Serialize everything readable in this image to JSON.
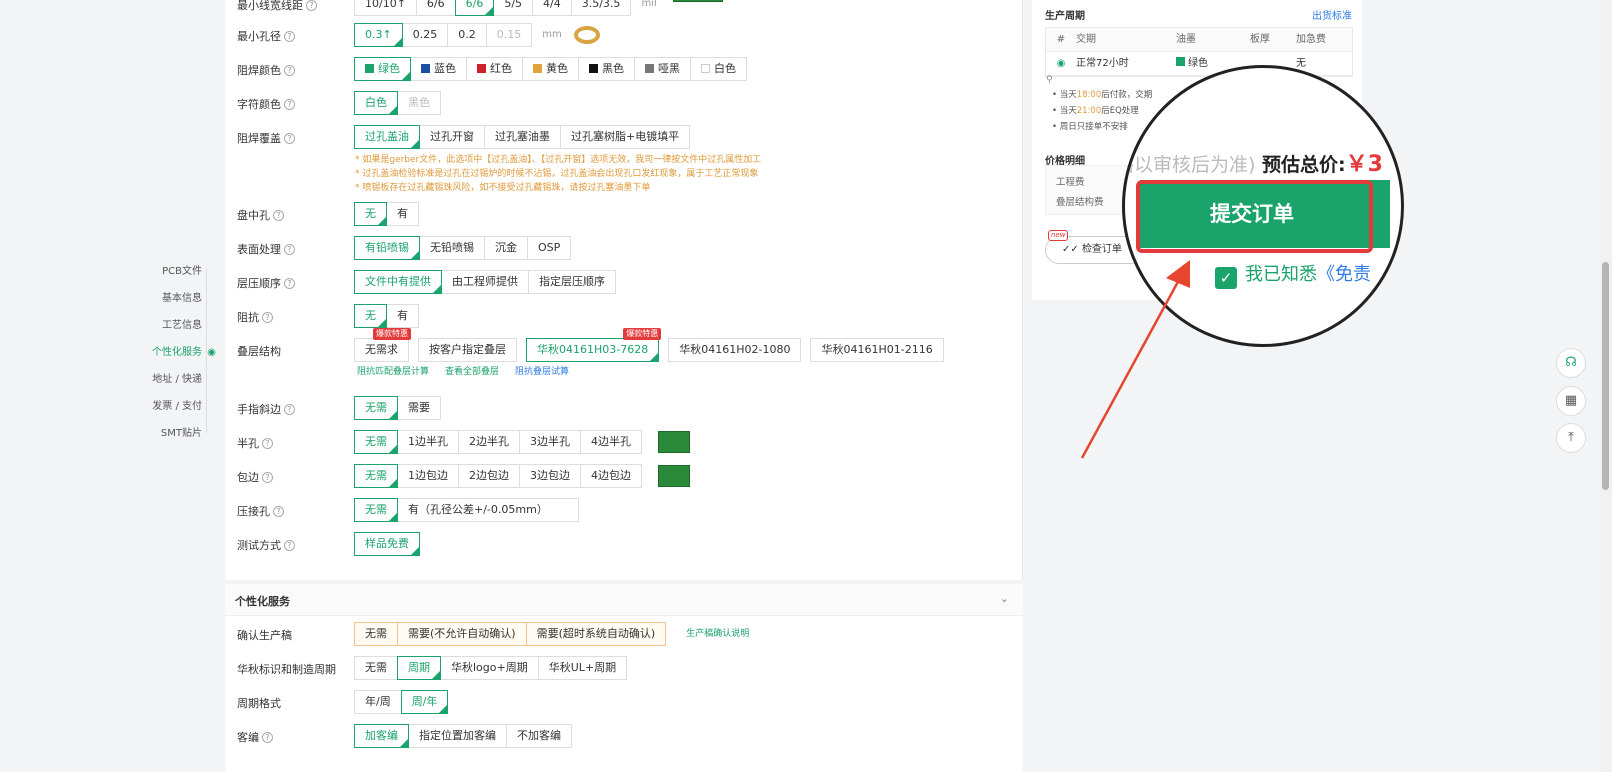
{
  "nav": {
    "items": [
      "PCB文件",
      "基本信息",
      "工艺信息",
      "个性化服务",
      "地址 / 快递",
      "发票 / 支付",
      "SMT贴片"
    ],
    "active_index": 3,
    "pin_icon": "location-pin-icon"
  },
  "spec": {
    "trace": {
      "label": "最小线宽线距",
      "options": [
        "10/10↑",
        "6/6",
        "6/6",
        "5/5",
        "4/4",
        "3.5/3.5"
      ],
      "selected": 2,
      "unit": "mil"
    },
    "hole": {
      "label": "最小孔径",
      "options": [
        "0.3↑",
        "0.25",
        "0.2",
        "0.15"
      ],
      "selected": 0,
      "unit": "mm"
    },
    "mask_color": {
      "label": "阻焊颜色",
      "options": [
        "绿色",
        "蓝色",
        "红色",
        "黄色",
        "黑色",
        "哑黑",
        "白色"
      ],
      "swatches": [
        "#1aa36b",
        "#1c4fa3",
        "#d0202a",
        "#e0a23b",
        "#111111",
        "#777777",
        "#ffffff"
      ],
      "selected": 0
    },
    "silk_color": {
      "label": "字符颜色",
      "options": [
        "白色",
        "黑色"
      ],
      "selected": 0
    },
    "mask_cover": {
      "label": "阻焊覆盖",
      "options": [
        "过孔盖油",
        "过孔开窗",
        "过孔塞油墨",
        "过孔塞树脂+电镀填平"
      ],
      "selected": 0
    },
    "mask_notes": [
      "* 如果是gerber文件，此选项中【过孔盖油】、【过孔开窗】选项无效，我司一律按文件中过孔属性加工",
      "* 过孔盖油检验标准是过孔在过锡炉的时候不沾锡，过孔盖油会出现孔口发红现象，属于工艺正常现象",
      "* 喷锡板存在过孔藏锡珠风险，如不接受过孔藏锡珠，请按过孔塞油墨下单"
    ],
    "via_in_pad": {
      "label": "盘中孔",
      "options": [
        "无",
        "有"
      ],
      "selected": 0
    },
    "surface": {
      "label": "表面处理",
      "options": [
        "有铅喷锡",
        "无铅喷锡",
        "沉金",
        "OSP"
      ],
      "selected": 0
    },
    "layer_order": {
      "label": "层压顺序",
      "options": [
        "文件中有提供",
        "由工程师提供",
        "指定层压顺序"
      ],
      "selected": 0
    },
    "impedance": {
      "label": "阻抗",
      "options": [
        "无",
        "有"
      ],
      "selected": 0
    },
    "stackup": {
      "label": "叠层结构",
      "options": [
        "无需求",
        "按客户指定叠层",
        "华秋04161H03-7628",
        "华秋04161H02-1080",
        "华秋04161H01-2116"
      ],
      "selected": 2,
      "hot_tag": "爆款特惠",
      "links": [
        "阻抗匹配叠层计算",
        "查看全部叠层",
        "阻抗叠层试算"
      ]
    },
    "bevel": {
      "label": "手指斜边",
      "options": [
        "无需",
        "需要"
      ],
      "selected": 0
    },
    "half_hole": {
      "label": "半孔",
      "options": [
        "无需",
        "1边半孔",
        "2边半孔",
        "3边半孔",
        "4边半孔"
      ],
      "selected": 0
    },
    "edge_plating": {
      "label": "包边",
      "options": [
        "无需",
        "1边包边",
        "2边包边",
        "3边包边",
        "4边包边"
      ],
      "selected": 0
    },
    "press_fit": {
      "label": "压接孔",
      "options": [
        "无需",
        "有（孔径公差+/-0.05mm）"
      ],
      "selected": 0
    },
    "test": {
      "label": "测试方式",
      "options": [
        "样品免费"
      ],
      "selected": 0
    }
  },
  "personal": {
    "title": "个性化服务",
    "confirm": {
      "label": "确认生产稿",
      "options": [
        "无需",
        "需要(不允许自动确认)",
        "需要(超时系统自动确认)"
      ],
      "link": "生产稿确认说明"
    },
    "marking": {
      "label": "华秋标识和制造周期",
      "options": [
        "无需",
        "周期",
        "华秋logo+周期",
        "华秋UL+周期"
      ],
      "selected": 1
    },
    "period_format": {
      "label": "周期格式",
      "options": [
        "年/周",
        "周/年"
      ],
      "selected": 1
    },
    "serial": {
      "label": "客编",
      "options": [
        "加客编",
        "指定位置加客编",
        "不加客编"
      ],
      "selected": 0
    }
  },
  "right": {
    "cycle_title": "生产周期",
    "cycle_link": "出货标准",
    "table_headers": [
      "#",
      "交期",
      "油墨",
      "板厚",
      "加急费"
    ],
    "table_row": {
      "delivery": "正常72小时",
      "ink": "绿色",
      "urgent": "无"
    },
    "notes": [
      {
        "pre": "当天",
        "em": "18:00",
        "post": "后付款，交期"
      },
      {
        "pre": "当天",
        "em": "21:00",
        "post": "后EQ处理"
      },
      {
        "pre": "周日只接单不安排",
        "em": "",
        "post": ""
      }
    ],
    "price_title": "价格明细",
    "price_rows": [
      "工程费",
      "叠层结构费"
    ],
    "check_button": "检查订单",
    "new_tag": "new"
  },
  "magnifier": {
    "grey_text": "格以审核后为准)",
    "total_label": "预估总价:",
    "total_value": "￥3",
    "submit": "提交订单",
    "agree_text": "我已知悉",
    "agree_link": "《免责"
  },
  "fabs": [
    "headset-icon",
    "qrcode-icon",
    "back-to-top-icon"
  ]
}
